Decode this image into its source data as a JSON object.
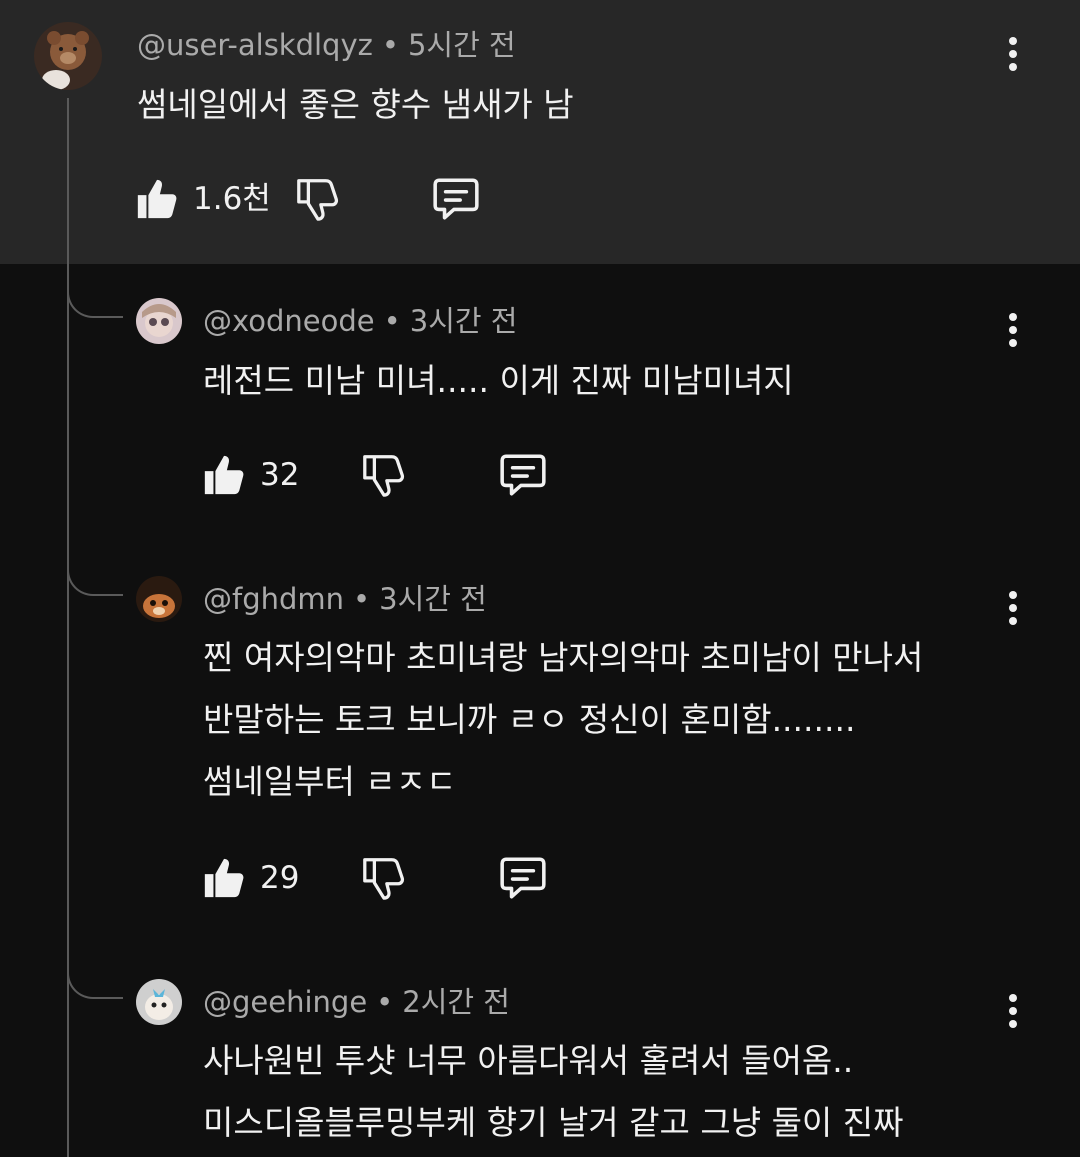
{
  "colors": {
    "top_comment_bg": "#272727",
    "page_bg": "#0f0f0f",
    "text": "#f1f1f1",
    "meta_text": "#aaaaaa",
    "thread_line": "#5a5a5a"
  },
  "icons": {
    "like": "thumbs-up-icon",
    "dislike": "thumbs-down-icon",
    "reply": "reply-comment-icon",
    "more": "more-vert-icon"
  },
  "comments": [
    {
      "handle": "@user-alskdlqyz",
      "separator": "•",
      "time": "5시간 전",
      "lines": [
        "썸네일에서 좋은 향수 냄새가 남"
      ],
      "likes": "1.6천"
    },
    {
      "handle": "@xodneode",
      "separator": "•",
      "time": "3시간 전",
      "lines": [
        "레전드 미남 미녀..... 이게 진짜 미남미녀지"
      ],
      "likes": "32"
    },
    {
      "handle": "@fghdmn",
      "separator": "•",
      "time": "3시간 전",
      "lines": [
        "찐 여자의악마 초미녀랑 남자의악마 초미남이 만나서",
        "반말하는 토크 보니까 ㄹㅇ 정신이 혼미함........",
        "썸네일부터 ㄹㅈㄷ"
      ],
      "likes": "29"
    },
    {
      "handle": "@geehinge",
      "separator": "•",
      "time": "2시간 전",
      "lines": [
        "사나원빈 투샷 너무 아름다워서 홀려서 들어옴..",
        "미스디올블루밍부케 향기 날거 같고 그냥 둘이 진짜"
      ]
    }
  ]
}
